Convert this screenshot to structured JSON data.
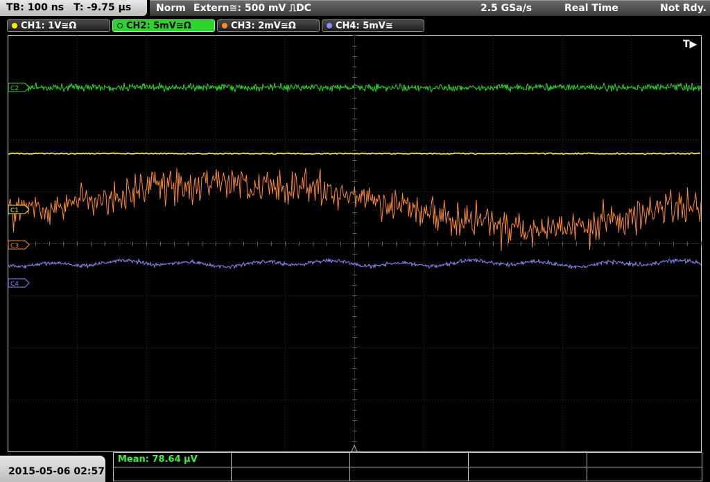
{
  "status": {
    "timebase": "TB: 100 ns",
    "trigger_time": "T: -9.75 µs",
    "mode": "Norm",
    "trigger_source": "Extern≅: 500 mV ⎍DC",
    "sample_rate": "2.5 GSa/s",
    "acq_mode": "Real Time",
    "state": "Not Rdy."
  },
  "channels": [
    {
      "label": "CH1: 1V≅Ω",
      "color": "#ffee00"
    },
    {
      "label": "CH2: 5mV≅Ω",
      "color": "#2bd52b",
      "active": true
    },
    {
      "label": "CH3: 2mV≅Ω",
      "color": "#ff8a2a"
    },
    {
      "label": "CH4: 5mV≅",
      "color": "#8a8aff"
    }
  ],
  "markers": {
    "trigger": "T▶",
    "ch1": "C1",
    "ch2": "C2",
    "ch3": "C3",
    "ch4": "C4"
  },
  "bottom": {
    "datetime": "2015-05-06 02:57",
    "measurement": "Mean: 78.64 µV"
  }
}
